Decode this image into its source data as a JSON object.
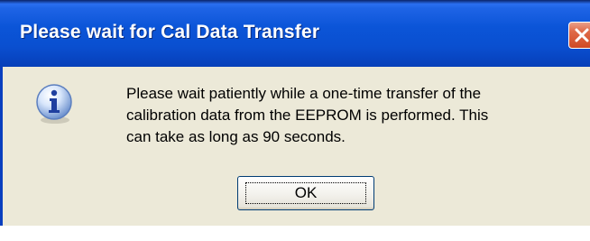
{
  "dialog": {
    "title": "Please wait for Cal Data Transfer",
    "close_icon": "close-icon",
    "info_icon": "info-icon",
    "message_lines": [
      "Please wait patiently while a one-time transfer of the",
      "calibration data from the EEPROM is performed.  This",
      "can take as long as 90 seconds."
    ],
    "ok_label": "OK"
  },
  "colors": {
    "title_bar": "#0b55d8",
    "window_background": "#ece9d8",
    "close_button": "#cf4a26",
    "title_text": "#ffffff"
  }
}
